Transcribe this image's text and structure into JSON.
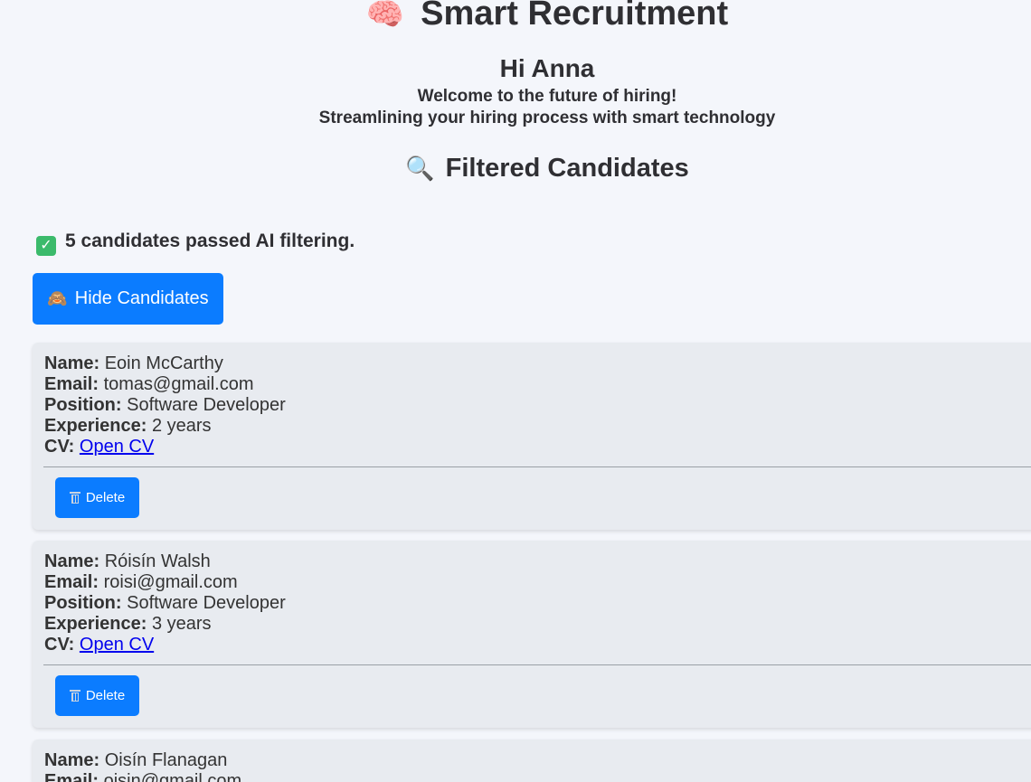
{
  "header": {
    "logo_icon": "brain-icon",
    "title": "Smart Recruitment",
    "greeting": "Hi Anna",
    "tagline1": "Welcome to the future of hiring!",
    "tagline2": "Streamlining your hiring process with smart technology"
  },
  "section": {
    "icon": "magnifier-icon",
    "title": "Filtered Candidates"
  },
  "status": {
    "icon": "check-icon",
    "text": "5 candidates passed AI filtering."
  },
  "toggle_button": {
    "icon": "see-no-evil-monkey-icon",
    "label": "Hide Candidates"
  },
  "labels": {
    "name": "Name:",
    "email": "Email:",
    "position": "Position:",
    "experience": "Experience:",
    "cv": "CV:"
  },
  "candidates": [
    {
      "name": "Eoin McCarthy",
      "email": "tomas@gmail.com",
      "position": "Software Developer",
      "experience": "2 years",
      "cv_link": "Open CV",
      "delete_label": "Delete"
    },
    {
      "name": "Róisín Walsh",
      "email": "roisi@gmail.com",
      "position": "Software Developer",
      "experience": "3 years",
      "cv_link": "Open CV",
      "delete_label": "Delete"
    },
    {
      "name": "Oisín Flanagan",
      "email": "oisin@gmail.com"
    }
  ],
  "colors": {
    "primary": "#0b7cff",
    "background": "#f4f6fb",
    "card": "#e8ebf0",
    "link": "#0000ee"
  }
}
